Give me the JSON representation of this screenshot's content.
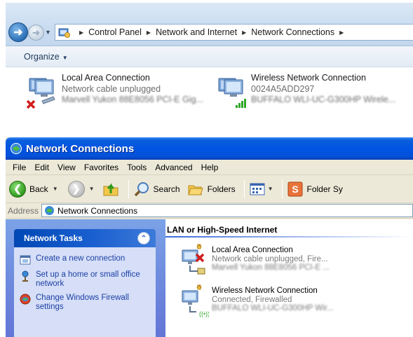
{
  "win7": {
    "breadcrumbs": [
      "Control Panel",
      "Network and Internet",
      "Network Connections"
    ],
    "organize_label": "Organize",
    "connections": [
      {
        "name": "Local Area Connection",
        "status": "Network cable unplugged",
        "device": "Marvell Yukon 88E8056 PCI-E Gig..."
      },
      {
        "name": "Wireless Network Connection",
        "status": "0024A5ADD297",
        "device": "BUFFALO WLI-UC-G300HP Wirele..."
      }
    ]
  },
  "winxp": {
    "title": "Network Connections",
    "menu": [
      "File",
      "Edit",
      "View",
      "Favorites",
      "Tools",
      "Advanced",
      "Help"
    ],
    "toolbar": {
      "back": "Back",
      "search": "Search",
      "folders": "Folders",
      "folder_sync": "Folder Sy"
    },
    "address_label": "Address",
    "address_value": "Network Connections",
    "tasks_title": "Network Tasks",
    "tasks": [
      "Create a new connection",
      "Set up a home or small office network",
      "Change Windows Firewall settings"
    ],
    "group_header": "LAN or High-Speed Internet",
    "connections": [
      {
        "name": "Local Area Connection",
        "status": "Network cable unplugged, Fire...",
        "device": "Marvell Yukon 88E8056 PCI-E ..."
      },
      {
        "name": "Wireless Network Connection",
        "status": "Connected, Firewalled",
        "device": "BUFFALO WLI-UC-G300HP Wir..."
      }
    ]
  },
  "colors": {
    "xp_title_blue": "#0054e3",
    "xp_task_link": "#1c3fa5",
    "win7_addr_bg": "#c9dcf0",
    "error_red": "#d21e1e",
    "signal_green": "#2fa82a"
  }
}
